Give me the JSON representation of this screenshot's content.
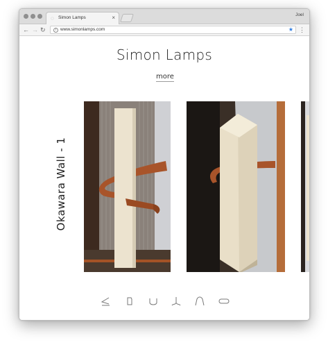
{
  "browser": {
    "tab_title": "Simon Lamps",
    "tab_close": "×",
    "profile_name": "Joel",
    "url": "www.simonlamps.com",
    "icons": [
      "favicon-icon",
      "back-icon",
      "forward-icon",
      "reload-icon",
      "info-icon",
      "bookmark-star-icon",
      "menu-icon"
    ]
  },
  "page": {
    "title": "Simon Lamps",
    "more_label": "more",
    "lamp_name": "Okawara Wall - 1",
    "photos": [
      "lamp-photo-front",
      "lamp-photo-angle",
      "lamp-photo-partial"
    ],
    "shape_selector": [
      "shape-icon-1",
      "shape-icon-2",
      "shape-icon-3",
      "shape-icon-4",
      "shape-icon-5",
      "shape-icon-6"
    ]
  },
  "colors": {
    "accent_blue": "#2f7de1",
    "wood_band": "#a8542a",
    "shade": "#ece3cf"
  }
}
